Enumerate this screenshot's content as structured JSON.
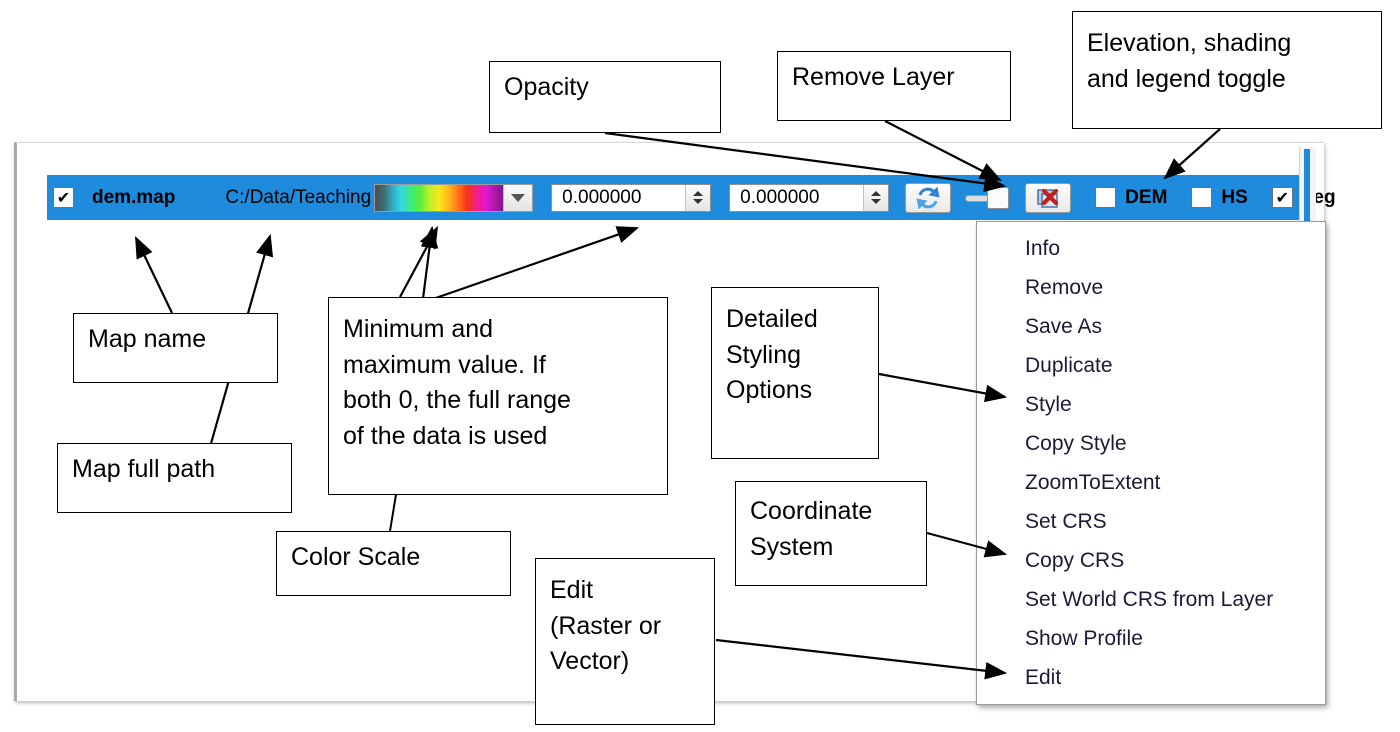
{
  "app": {
    "layer_row": {
      "visible_checkbox_checked": true,
      "map_name": "dem.map",
      "map_path": "C:/Data/Teaching",
      "color_ramp": "rainbow-gradient",
      "min_value": "0.000000",
      "max_value": "0.000000",
      "refresh_icon": "refresh-icon",
      "remove_icon": "remove-layer-icon",
      "opacity_value": 100,
      "toggles": [
        {
          "label": "DEM",
          "checked": false
        },
        {
          "label": "HS",
          "checked": false
        },
        {
          "label": "Leg",
          "checked": true
        }
      ]
    },
    "context_menu": {
      "items": [
        "Info",
        "Remove",
        "Save As",
        "Duplicate",
        "Style",
        "Copy Style",
        "ZoomToExtent",
        "Set CRS",
        "Copy CRS",
        "Set World CRS from Layer",
        "Show Profile",
        "Edit"
      ]
    }
  },
  "annotations": [
    {
      "id": "opacity",
      "text": "Opacity"
    },
    {
      "id": "remove-layer",
      "text": "Remove Layer"
    },
    {
      "id": "elevation",
      "text": "Elevation, shading\nand legend toggle"
    },
    {
      "id": "map-name",
      "text": "Map name"
    },
    {
      "id": "map-full-path",
      "text": "Map full path"
    },
    {
      "id": "min-max",
      "text": "Minimum and\nmaximum value. If\nboth 0, the full range\nof the data is used"
    },
    {
      "id": "color-scale",
      "text": "Color Scale"
    },
    {
      "id": "detailed-style",
      "text": "Detailed\nStyling\nOptions"
    },
    {
      "id": "coordinate-sys",
      "text": "Coordinate\nSystem"
    },
    {
      "id": "edit",
      "text": "Edit\n(Raster or\nVector)"
    }
  ],
  "colors": {
    "selection_blue": "#1e8bdc",
    "annotation_border": "#000000",
    "menu_text": "#1b1b38"
  }
}
